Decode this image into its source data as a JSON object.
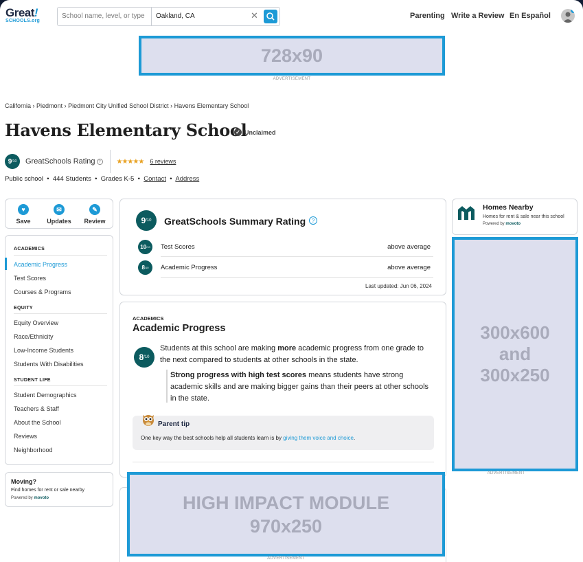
{
  "header": {
    "logo_top": "Great",
    "logo_bang": "!",
    "logo_bottom": "SCHOOLS.org",
    "search_placeholder": "School name, level, or type",
    "search_location": "Oakland, CA",
    "clear_glyph": "✕",
    "nav": [
      "Parenting",
      "Write a Review",
      "En Español"
    ]
  },
  "ads": {
    "top": "728x90",
    "side": "300x600\nand\n300x250",
    "bottom": "HIGH IMPACT MODULE\n970x250",
    "label": "ADVERTISEMENT"
  },
  "breadcrumb": [
    "California",
    "Piedmont",
    "Piedmont City Unified School District",
    "Havens Elementary School"
  ],
  "school": {
    "name": "Havens Elementary School",
    "claim_status": "Unclaimed",
    "rating": "9",
    "rating_denom": "/10",
    "rating_label": "GreatSchools Rating",
    "stars": "★★★★★",
    "star_count": 4.5,
    "reviews": "6 reviews",
    "facts": [
      "Public school",
      "444 Students",
      "Grades K-5",
      "Contact",
      "Address"
    ]
  },
  "actions": [
    {
      "label": "Save",
      "icon": "heart-icon"
    },
    {
      "label": "Updates",
      "icon": "mail-icon"
    },
    {
      "label": "Review",
      "icon": "pencil-icon"
    }
  ],
  "sidebar": {
    "sections": [
      {
        "heading": "ACADEMICS",
        "items": [
          "Academic Progress",
          "Test Scores",
          "Courses & Programs"
        ]
      },
      {
        "heading": "EQUITY",
        "items": [
          "Equity Overview",
          "Race/Ethnicity",
          "Low-Income Students",
          "Students With Disabilities"
        ]
      },
      {
        "heading": "STUDENT LIFE",
        "items": [
          "Student Demographics",
          "Teachers & Staff",
          "About the School",
          "Reviews",
          "Neighborhood"
        ]
      }
    ],
    "active": "Academic Progress",
    "moving": {
      "title": "Moving?",
      "text": "Find homes for rent or sale nearby",
      "powered": "Powered by",
      "brand": "movoto"
    }
  },
  "summary": {
    "rating": "9",
    "rating_denom": "/10",
    "title": "GreatSchools Summary Rating",
    "help": "?",
    "rows": [
      {
        "rating": "10",
        "label": "Test Scores",
        "value": "above average"
      },
      {
        "rating": "8",
        "label": "Academic Progress",
        "value": "above average"
      }
    ],
    "updated": "Last updated: Jun 06, 2024"
  },
  "academic_progress": {
    "kicker": "ACADEMICS",
    "title": "Academic Progress",
    "rating": "8",
    "rating_denom": "/10",
    "text_before": "Students at this school are making ",
    "text_bold": "more",
    "text_after": " academic progress from one grade to the next compared to students at other schools in the state.",
    "quote_bold": "Strong progress with high test scores",
    "quote_rest": " means students have strong academic skills and are making bigger gains than their peers at other schools in the state.",
    "tip_title": "Parent tip",
    "tip_text": "One key way the best schools help all students learn is by ",
    "tip_link": "giving them voice and choice",
    "tip_end": "."
  },
  "homes": {
    "title": "Homes Nearby",
    "subtitle": "Homes for rent & sale near this school",
    "powered": "Powered by",
    "brand": "movoto"
  },
  "colors": {
    "accent": "#1d9ad6",
    "badge": "#0c5b5f",
    "navy": "#101b33",
    "star": "#e8a224"
  }
}
